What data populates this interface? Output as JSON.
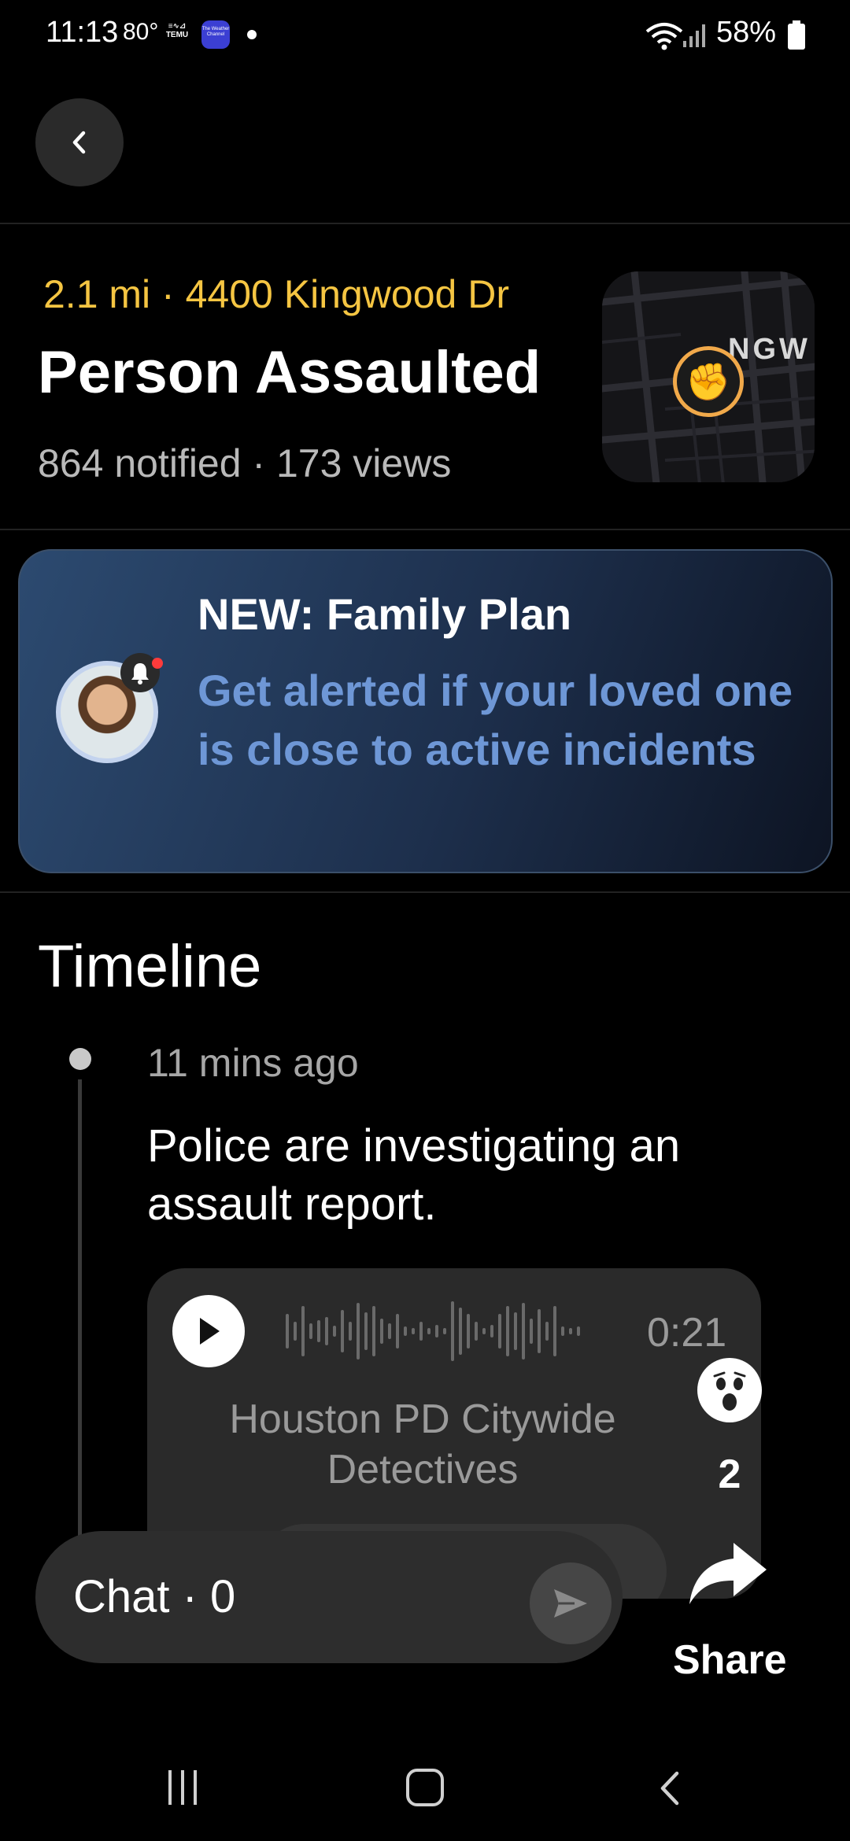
{
  "status_bar": {
    "time": "11:13",
    "temp": "80°",
    "temu_label": "TEMU",
    "weather_app": "The Weather Channel",
    "battery": "58%"
  },
  "incident": {
    "distance_address": "2.1 mi · 4400 Kingwood Dr",
    "title": "Person Assaulted",
    "stats": "864 notified · 173 views",
    "map_label": "NGW",
    "category_icon": "fist-icon"
  },
  "promo": {
    "title": "NEW: Family Plan",
    "body": "Get alerted if your loved one is close to active incidents"
  },
  "timeline": {
    "heading": "Timeline",
    "entries": [
      {
        "time": "11 mins ago",
        "text": "Police are investigating an assault report.",
        "audio": {
          "duration": "0:21",
          "source": "Houston PD Citywide Detectives"
        }
      }
    ]
  },
  "reaction": {
    "emoji": "scared-face",
    "count": "2"
  },
  "chat": {
    "label": "Chat · 0"
  },
  "share": {
    "label": "Share"
  },
  "colors": {
    "accent_yellow": "#f5c542",
    "promo_link": "#6e97d6",
    "background": "#000000"
  }
}
